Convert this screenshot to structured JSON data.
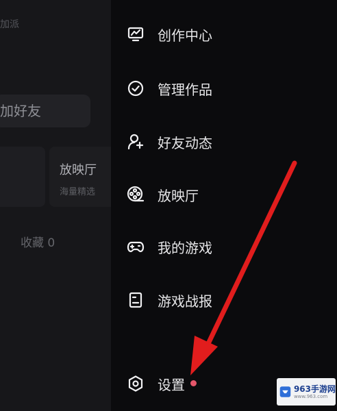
{
  "left_panel": {
    "top_fragment": "加派",
    "add_friend_label": "加好友",
    "cinema_card": {
      "title": "放映厅",
      "subtitle": "海量精选"
    },
    "favorites_label": "收藏 0"
  },
  "menu": {
    "items": [
      {
        "label": "创作中心",
        "icon": "monitor-chart-icon"
      },
      {
        "label": "管理作品",
        "icon": "check-circle-icon"
      },
      {
        "label": "好友动态",
        "icon": "person-sparkle-icon"
      },
      {
        "label": "放映厅",
        "icon": "film-reel-icon"
      },
      {
        "label": "我的游戏",
        "icon": "gamepad-icon"
      },
      {
        "label": "游戏战报",
        "icon": "report-icon"
      },
      {
        "label": "设置",
        "icon": "settings-hexagon-icon",
        "has_badge": true
      }
    ]
  },
  "annotation": {
    "arrow_color": "#e11d1d"
  },
  "watermark": {
    "name": "963手游网",
    "url": "www.963.com"
  }
}
